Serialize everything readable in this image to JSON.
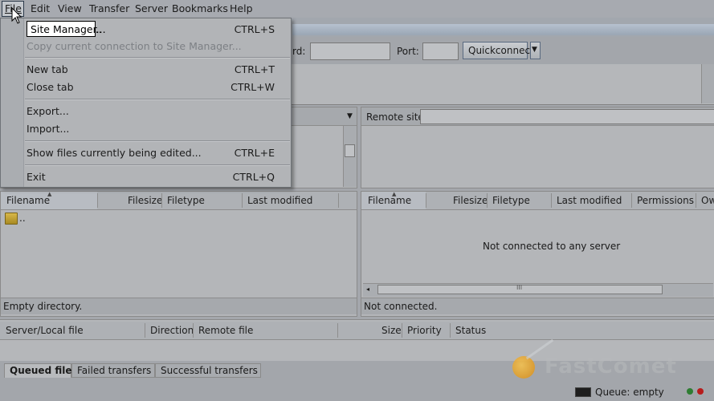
{
  "menubar": {
    "items": [
      {
        "label": "File"
      },
      {
        "label": "Edit"
      },
      {
        "label": "View"
      },
      {
        "label": "Transfer"
      },
      {
        "label": "Server"
      },
      {
        "label": "Bookmarks"
      },
      {
        "label": "Help"
      }
    ]
  },
  "file_menu": {
    "items": [
      {
        "label": "Site Manager...",
        "shortcut": "CTRL+S"
      },
      {
        "label": "Copy current connection to Site Manager...",
        "shortcut": ""
      },
      {
        "label": "New tab",
        "shortcut": "CTRL+T"
      },
      {
        "label": "Close tab",
        "shortcut": "CTRL+W"
      },
      {
        "label": "Export...",
        "shortcut": ""
      },
      {
        "label": "Import...",
        "shortcut": ""
      },
      {
        "label": "Show files currently being edited...",
        "shortcut": "CTRL+E"
      },
      {
        "label": "Exit",
        "shortcut": "CTRL+Q"
      }
    ]
  },
  "quickconnect": {
    "password_label": "rd:",
    "port_label": "Port:",
    "button_label": "Quickconnect",
    "dropdown_arrow": "▼"
  },
  "remote_site": {
    "label": "Remote site:"
  },
  "local_files": {
    "columns": [
      "Filename",
      "Filesize",
      "Filetype",
      "Last modified"
    ],
    "rows": [
      {
        "name": ".."
      }
    ],
    "status": "Empty directory."
  },
  "remote_files": {
    "columns": [
      "Filename",
      "Filesize",
      "Filetype",
      "Last modified",
      "Permissions",
      "Ow"
    ],
    "empty_message": "Not connected to any server",
    "status": "Not connected.",
    "scroll_grip": "III"
  },
  "queue": {
    "columns": [
      "Server/Local file",
      "Direction",
      "Remote file",
      "Size",
      "Priority",
      "Status"
    ]
  },
  "queue_tabs": [
    {
      "label": "Queued files",
      "active": true
    },
    {
      "label": "Failed transfers",
      "active": false
    },
    {
      "label": "Successful transfers",
      "active": false
    }
  ],
  "statusbar": {
    "queue_text": "Queue: empty"
  },
  "watermark": {
    "text": "FastComet"
  },
  "colors": {
    "accent": "#3d5a80",
    "led_green": "#2e7d32",
    "led_red": "#c62828",
    "logo_orange": "#f5a623"
  }
}
